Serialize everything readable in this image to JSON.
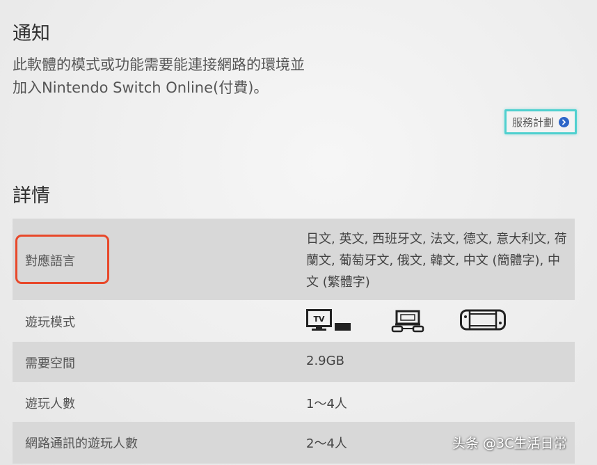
{
  "notice": {
    "title": "通知",
    "body_line1": "此軟體的模式或功能需要能連接網路的環境並",
    "body_line2": "加入Nintendo Switch Online(付費)。",
    "plan_button_label": "服務計劃"
  },
  "details": {
    "title": "詳情",
    "rows": {
      "languages": {
        "label": "對應語言",
        "value": "日文, 英文, 西班牙文, 法文, 德文, 意大利文, 荷蘭文, 葡萄牙文, 俄文, 韓文, 中文 (簡體字), 中文 (繁體字)"
      },
      "play_mode": {
        "label": "遊玩模式",
        "icons": [
          "tv-mode-icon",
          "tabletop-mode-icon",
          "handheld-mode-icon"
        ],
        "tv_badge": "TV"
      },
      "space": {
        "label": "需要空間",
        "value": "2.9GB"
      },
      "players": {
        "label": "遊玩人數",
        "value": "1～4人"
      },
      "online_players": {
        "label": "網路通訊的遊玩人數",
        "value": "2～4人"
      }
    }
  },
  "watermark": "头条 @3C生活日常",
  "colors": {
    "button_border": "#4fd0cf",
    "button_arrow": "#2d66c8",
    "highlight": "#e8482a",
    "row_shade": "#d8d8d8"
  }
}
